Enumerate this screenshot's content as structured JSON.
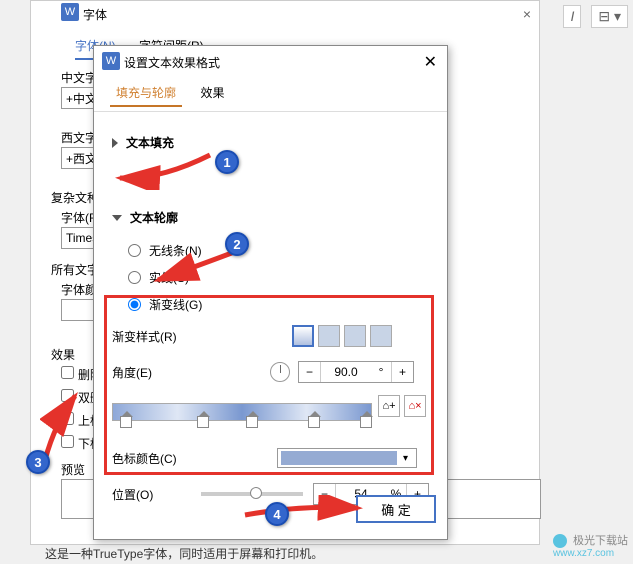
{
  "bg": {
    "title": "字体",
    "tabs": [
      "字体(N)",
      "字符间距(R)"
    ],
    "labels": {
      "cn_font": "中文字体(T):",
      "cn_val": "+中文",
      "west_font": "西文字体(X):",
      "west_val": "+西文",
      "complex": "复杂文种",
      "font_f": "字体(F):",
      "font_f_val": "Times",
      "all_text": "所有文字",
      "font_color": "字体颜色",
      "effects": "效果",
      "cb1": "删除",
      "cb2": "双删",
      "cb3": "上标",
      "cb4": "下标",
      "preview": "预览"
    },
    "footer": "这是一种TrueType字体，同时适用于屏幕和打印机。"
  },
  "dialog": {
    "title": "设置文本效果格式",
    "tabs": {
      "t1": "填充与轮廓",
      "t2": "效果"
    },
    "sections": {
      "fill": "文本填充",
      "outline": "文本轮廓"
    },
    "radios": {
      "none": "无线条(N)",
      "solid": "实线(S)",
      "gradient": "渐变线(G)"
    },
    "grad": {
      "style": "渐变样式(R)",
      "angle": "角度(E)",
      "angle_val": "90.0",
      "angle_unit": "°",
      "minus": "−",
      "plus": "+",
      "color": "色标颜色(C)",
      "position": "位置(O)",
      "pos_val": "54",
      "pos_unit": "%"
    },
    "ok": "确 定"
  },
  "callouts": {
    "c1": "1",
    "c2": "2",
    "c3": "3",
    "c4": "4"
  },
  "watermark": {
    "name": "极光下载站",
    "url": "www.xz7.com"
  },
  "ribbon": {
    "i": "I"
  }
}
